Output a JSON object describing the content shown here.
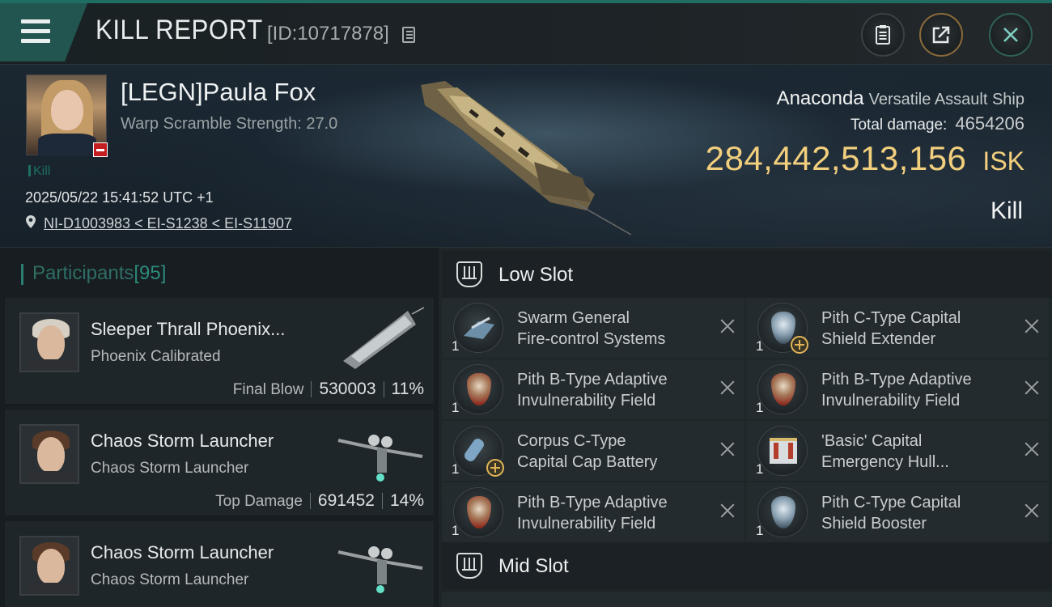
{
  "header": {
    "title": "KILL REPORT",
    "report_id": "[ID:10717878]"
  },
  "victim": {
    "name": "[LEGN]Paula Fox",
    "scramble": "Warp Scramble Strength: 27.0",
    "kill_tag": "Kill",
    "timestamp": "2025/05/22 15:41:52 UTC +1",
    "location": "NI-D1003983 < EI-S1238 < EI-S11907",
    "ship_name": "Anaconda",
    "ship_class": "Versatile Assault Ship",
    "damage_label": "Total damage:",
    "damage_value": "4654206",
    "isk_value": "284,442,513,156",
    "isk_unit": "ISK",
    "result": "Kill"
  },
  "participants": {
    "label": "Participants",
    "count": "[95]",
    "items": [
      {
        "name": "Sleeper Thrall Phoenix...",
        "ship": "Phoenix Calibrated",
        "role": "Final Blow",
        "damage": "530003",
        "percent": "11%"
      },
      {
        "name": "Chaos Storm Launcher",
        "ship": "Chaos Storm Launcher",
        "role": "Top Damage",
        "damage": "691452",
        "percent": "14%"
      },
      {
        "name": "Chaos Storm Launcher",
        "ship": "Chaos Storm Launcher",
        "role": "",
        "damage": "",
        "percent": ""
      }
    ]
  },
  "slots": {
    "low_title": "Low Slot",
    "mid_title": "Mid Slot",
    "low": [
      {
        "line1": "Swarm General",
        "line2": "Fire-control Systems",
        "qty": "1"
      },
      {
        "line1": "Pith C-Type Capital",
        "line2": "Shield Extender",
        "qty": "1"
      },
      {
        "line1": "Pith B-Type Adaptive",
        "line2": "Invulnerability Field",
        "qty": "1"
      },
      {
        "line1": "Pith B-Type Adaptive",
        "line2": "Invulnerability Field",
        "qty": "1"
      },
      {
        "line1": "Corpus C-Type",
        "line2": "Capital Cap Battery",
        "qty": "1"
      },
      {
        "line1": "'Basic' Capital",
        "line2": "Emergency Hull...",
        "qty": "1"
      },
      {
        "line1": "Pith B-Type Adaptive",
        "line2": "Invulnerability Field",
        "qty": "1"
      },
      {
        "line1": "Pith C-Type Capital",
        "line2": "Shield Booster",
        "qty": "1"
      }
    ]
  },
  "colors": {
    "accent": "#1f6d63",
    "isk": "#f2cf7d"
  }
}
